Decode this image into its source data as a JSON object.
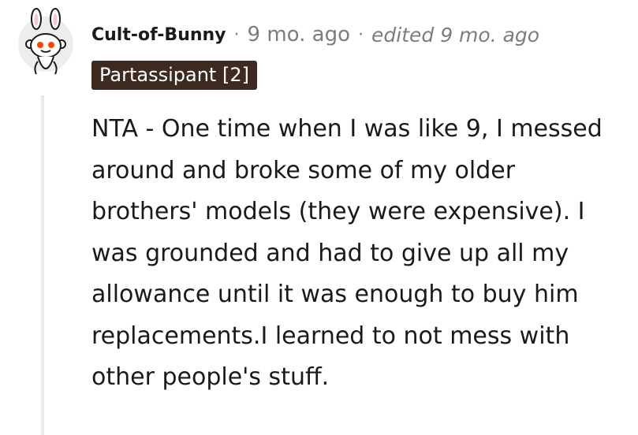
{
  "comment": {
    "author": "Cult-of-Bunny",
    "separator": "·",
    "timestamp": "9 mo. ago",
    "edited_label": "edited 9 mo. ago",
    "flair": "Partassipant [2]",
    "avatar_icon": "snoo-bunny-avatar-icon",
    "body": "NTA - One time when I was like 9, I messed around and broke some of my older brothers' models (they were expensive). I was grounded and had to give up all my allowance until it was enough to buy him replacements.I learned to not mess with other people's stuff."
  },
  "colors": {
    "flair_background": "#3d2a21",
    "flair_text": "#ffffff",
    "meta_text": "#7c7c7c",
    "body_text": "#1a1a1b",
    "thread_line": "#eaeaea",
    "snoo_eye": "#ff4500"
  }
}
